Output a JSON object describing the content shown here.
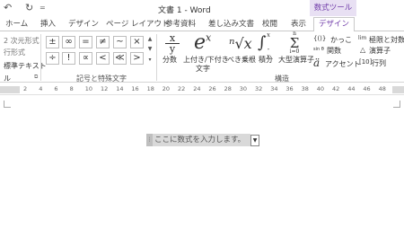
{
  "titlebar": {
    "title": "文書 1 - Word",
    "contextual_label": "数式ツール",
    "qa_undo": "↶",
    "qa_redo": "↻",
    "qa_more": "="
  },
  "tabs": [
    {
      "label": "ホーム"
    },
    {
      "label": "挿入"
    },
    {
      "label": "デザイン"
    },
    {
      "label": "ページ レイアウト"
    },
    {
      "label": "参考資料"
    },
    {
      "label": "差し込み文書"
    },
    {
      "label": "校閲"
    },
    {
      "label": "表示"
    },
    {
      "label": "デザイン"
    }
  ],
  "ribbon": {
    "tools": {
      "professional": "2 次元形式",
      "linear": "行形式",
      "normal_text": "標準テキスト"
    },
    "symbols_row1": [
      "±",
      "∞",
      "=",
      "≠",
      "~",
      "×"
    ],
    "symbols_row2": [
      "÷",
      "!",
      "∝",
      "<",
      "≪",
      ">"
    ],
    "symbols_group_label": "記号と特殊文字",
    "structures": {
      "fraction": {
        "glyph_top": "x",
        "glyph_bottom": "y",
        "label": "分数"
      },
      "script": {
        "glyph": "e",
        "glyph_sup": "x",
        "label_line1": "上付き/下付き",
        "label_line2": "文字"
      },
      "radical": {
        "glyph": "ⁿ√x",
        "label": "べき乗根"
      },
      "integral": {
        "glyph": "∫",
        "glyph_top": "x",
        "glyph_bottom": "-x",
        "label": "積分"
      },
      "large_operator": {
        "glyph": "Σ",
        "glyph_top": "n",
        "glyph_bottom": "i=0",
        "label": "大型演算子"
      },
      "bracket": {
        "glyph": "{()}",
        "label": "かっこ"
      },
      "function": {
        "glyph": "sin θ",
        "label": "関数"
      },
      "accent": {
        "glyph": "ä",
        "label": "アクセント"
      },
      "limit_log": {
        "glyph": "lim",
        "label": "極限と対数"
      },
      "operator": {
        "glyph": "△",
        "label": "演算子"
      },
      "matrix": {
        "glyph": "[10]",
        "label": "行列"
      }
    },
    "structures_group_label": "構造",
    "tools_group_label": "ル"
  },
  "ruler": {
    "numbers": [
      "2",
      "4",
      "6",
      "8",
      "10",
      "12",
      "14",
      "16",
      "18",
      "20",
      "22",
      "24",
      "26",
      "28",
      "30",
      "32",
      "34",
      "36",
      "38",
      "40",
      "42",
      "44",
      "46",
      "48"
    ]
  },
  "document": {
    "equation_placeholder": "ここに数式を入力します。",
    "equation_dropdown": "▼",
    "equation_handle": "⋮"
  }
}
